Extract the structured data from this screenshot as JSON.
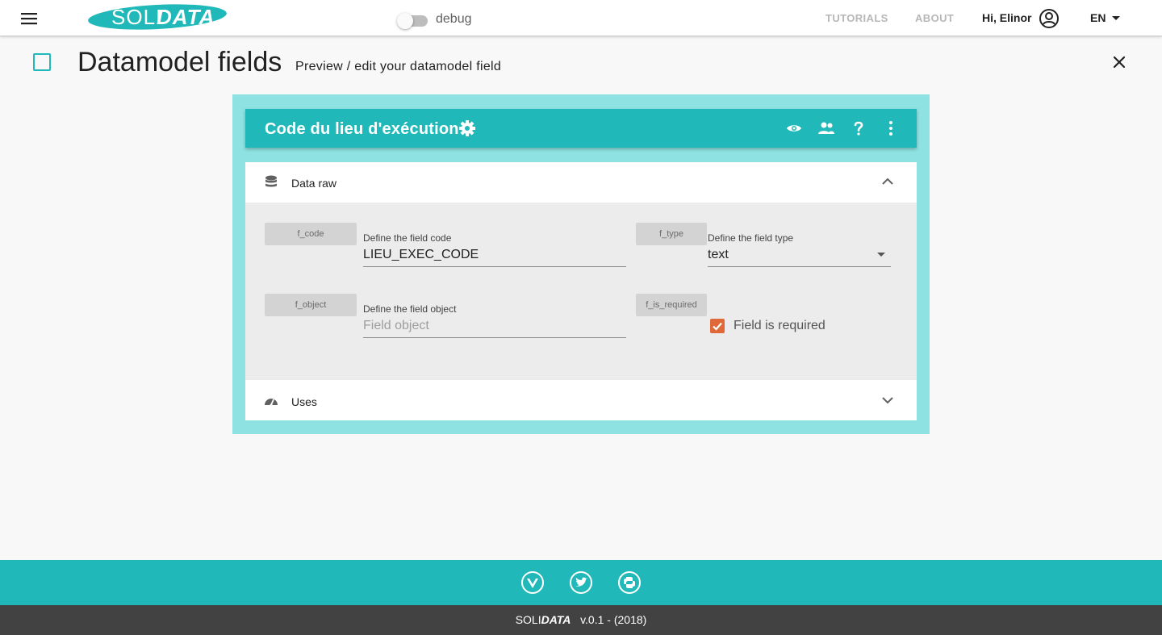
{
  "app": {
    "logo_left": "SOLI",
    "logo_right": "DATA"
  },
  "topbar": {
    "debug_label": "debug",
    "debug_on": false,
    "nav": [
      "TUTORIALS",
      "ABOUT"
    ],
    "greeting": "Hi, Elinor",
    "language": "EN"
  },
  "page": {
    "title": "Datamodel fields",
    "subtitle": "Preview / edit your datamodel field"
  },
  "card": {
    "title": "Code du lieu d'exécution",
    "toolbar_icons": [
      "eye-icon",
      "group-icon",
      "help-icon",
      "more-vert-icon"
    ],
    "panels": [
      {
        "title": "Data raw",
        "icon": "database-icon",
        "expanded": true
      },
      {
        "title": "Uses",
        "icon": "speedometer-icon",
        "expanded": false
      }
    ],
    "fields": {
      "code": {
        "chip": "f_code",
        "label": "Define the field code",
        "value": "LIEU_EXEC_CODE"
      },
      "type": {
        "chip": "f_type",
        "label": "Define the field type",
        "value": "text"
      },
      "object": {
        "chip": "f_object",
        "label": "Define the field object",
        "placeholder": "Field object"
      },
      "required": {
        "chip": "f_is_required",
        "label": "Field is required",
        "checked": true
      }
    }
  },
  "footer": {
    "icons": [
      "vue-icon",
      "twitter-icon",
      "python-icon"
    ],
    "brand_a": "SOLI",
    "brand_b": "DATA",
    "version": "v.0.1 - (2018)"
  },
  "colors": {
    "accent": "#20b8b8",
    "frame": "#8ee2e2",
    "checkbox": "#e0693a",
    "footer_dark": "#424242"
  }
}
